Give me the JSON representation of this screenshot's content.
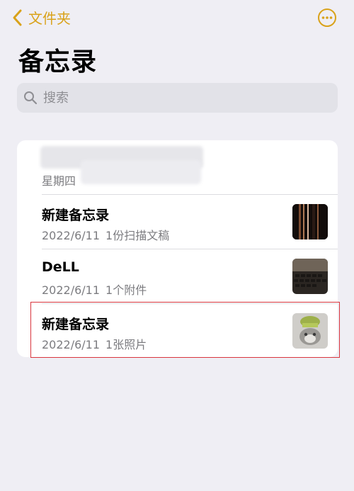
{
  "nav": {
    "back_label": "文件夹",
    "accent_color": "#d9a21a"
  },
  "page_title": "备忘录",
  "search": {
    "placeholder": "搜索"
  },
  "notes": [
    {
      "title": "",
      "date": "星期四",
      "detail": "",
      "redacted": true
    },
    {
      "title": "新建备忘录",
      "date": "2022/6/11",
      "detail": "1份扫描文稿",
      "thumbnail": "scan-thumbnail"
    },
    {
      "title": "DeLL",
      "date": "2022/6/11",
      "detail": "1个附件",
      "thumbnail": "keyboard-photo-thumbnail"
    },
    {
      "title": "新建备忘录",
      "date": "2022/6/11",
      "detail": "1张照片",
      "thumbnail": "cat-photo-thumbnail",
      "highlighted": true
    }
  ],
  "highlight_color": "#d9363e"
}
